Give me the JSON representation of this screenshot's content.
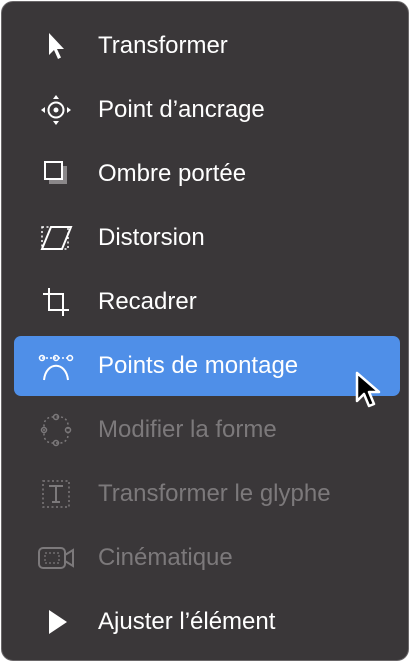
{
  "colors": {
    "menu_background": "#3a3739",
    "menu_border": "#6a6769",
    "text_enabled": "#ffffff",
    "text_disabled": "#7c797b",
    "selection_accent": "#4f8fe8"
  },
  "menu": {
    "items": [
      {
        "label": "Transformer",
        "icon": "arrow-pointer-icon",
        "state": "enabled"
      },
      {
        "label": "Point d’ancrage",
        "icon": "anchor-point-icon",
        "state": "enabled"
      },
      {
        "label": "Ombre portée",
        "icon": "drop-shadow-icon",
        "state": "enabled"
      },
      {
        "label": "Distorsion",
        "icon": "distort-icon",
        "state": "enabled"
      },
      {
        "label": "Recadrer",
        "icon": "crop-icon",
        "state": "enabled"
      },
      {
        "label": "Points de montage",
        "icon": "edit-points-icon",
        "state": "selected"
      },
      {
        "label": "Modifier la forme",
        "icon": "edit-shape-icon",
        "state": "disabled"
      },
      {
        "label": "Transformer le glyphe",
        "icon": "transform-glyph-icon",
        "state": "disabled"
      },
      {
        "label": "Cinématique",
        "icon": "camera-icon",
        "state": "disabled"
      },
      {
        "label": "Ajuster l’élément",
        "icon": "adjust-item-icon",
        "state": "enabled"
      }
    ]
  },
  "cursor": {
    "icon": "mouse-pointer-icon"
  }
}
